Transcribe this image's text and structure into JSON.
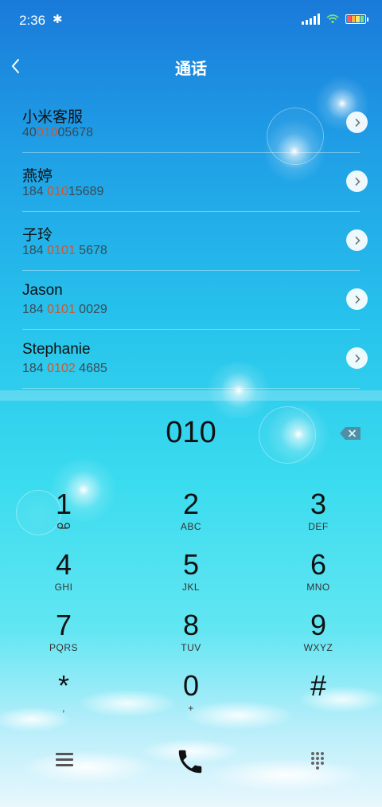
{
  "status": {
    "time": "2:36",
    "bluetooth_glyph": "✱",
    "battery_colors": [
      "#ff5a5a",
      "#ffb347",
      "#ffe85c",
      "#7fe07f"
    ]
  },
  "header": {
    "title": "通话",
    "back_icon": "chevron-left-icon"
  },
  "contacts": [
    {
      "name": "小米客服",
      "num_pre": "40",
      "num_hl": "010",
      "num_post": "05678"
    },
    {
      "name": "燕婷",
      "num_pre": "184 ",
      "num_hl": "010",
      "num_post": "15689"
    },
    {
      "name": "子玲",
      "num_pre": "184 ",
      "num_hl": "0101",
      "num_post": " 5678"
    },
    {
      "name": "Jason",
      "num_pre": "184 ",
      "num_hl": "0101",
      "num_post": " 0029"
    },
    {
      "name": "Stephanie",
      "num_pre": "184 ",
      "num_hl": "0102",
      "num_post": " 4685"
    }
  ],
  "dialer": {
    "input_value": "010",
    "keys": [
      {
        "digit": "1",
        "letters": "∞"
      },
      {
        "digit": "2",
        "letters": "ABC"
      },
      {
        "digit": "3",
        "letters": "DEF"
      },
      {
        "digit": "4",
        "letters": "GHI"
      },
      {
        "digit": "5",
        "letters": "JKL"
      },
      {
        "digit": "6",
        "letters": "MNO"
      },
      {
        "digit": "7",
        "letters": "PQRS"
      },
      {
        "digit": "8",
        "letters": "TUV"
      },
      {
        "digit": "9",
        "letters": "WXYZ"
      },
      {
        "digit": "*",
        "letters": ","
      },
      {
        "digit": "0",
        "letters": "+"
      },
      {
        "digit": "#",
        "letters": ""
      }
    ]
  },
  "colors": {
    "highlight": "#d4542a",
    "accent_top": "#1a7ad9",
    "accent_mid": "#3bdcef"
  }
}
